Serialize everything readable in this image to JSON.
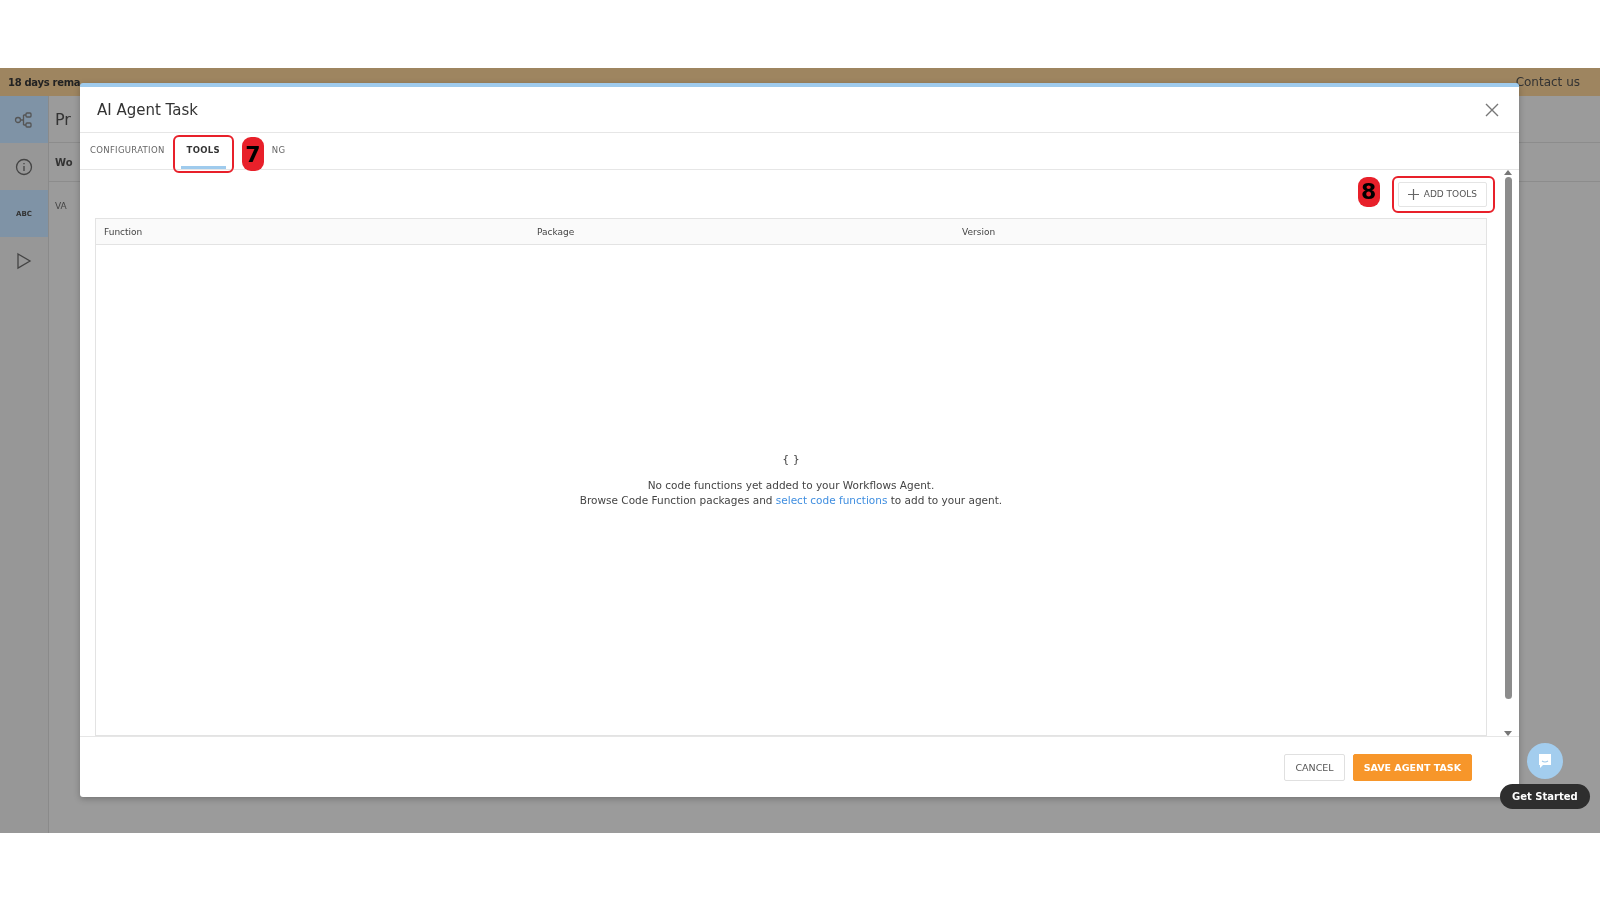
{
  "banner": {
    "text": "18 days rema",
    "contact": "Contact us"
  },
  "background": {
    "title": "Pr",
    "section": "Wo",
    "label": "VA",
    "rail_items": [
      {
        "kind": "flow",
        "selected": true
      },
      {
        "kind": "info",
        "selected": false
      },
      {
        "kind": "text",
        "label": "ABC",
        "selected": true
      },
      {
        "kind": "play",
        "selected": false
      }
    ]
  },
  "dialog": {
    "title": "AI Agent Task",
    "tabs": [
      {
        "label": "CONFIGURATION",
        "selected": false
      },
      {
        "label": "TOOLS",
        "selected": true
      },
      {
        "label": "NG",
        "selected": false
      }
    ],
    "add_button": "ADD TOOLS",
    "table": {
      "columns": [
        "Function",
        "Package",
        "Version"
      ]
    },
    "empty_state": {
      "icon": "{ }",
      "line1": "No code functions yet added to your Workflows Agent.",
      "line2_before": "Browse Code Function packages and",
      "line2_link": "select code functions",
      "line2_after": "to add to your agent."
    },
    "buttons": [
      {
        "label": "CANCEL",
        "kind": "secondary"
      },
      {
        "label": "SAVE AGENT TASK",
        "kind": "primary"
      }
    ]
  },
  "annotations": [
    {
      "label": "7"
    },
    {
      "label": "8"
    }
  ],
  "chat": {
    "tooltip": "Get Started"
  }
}
